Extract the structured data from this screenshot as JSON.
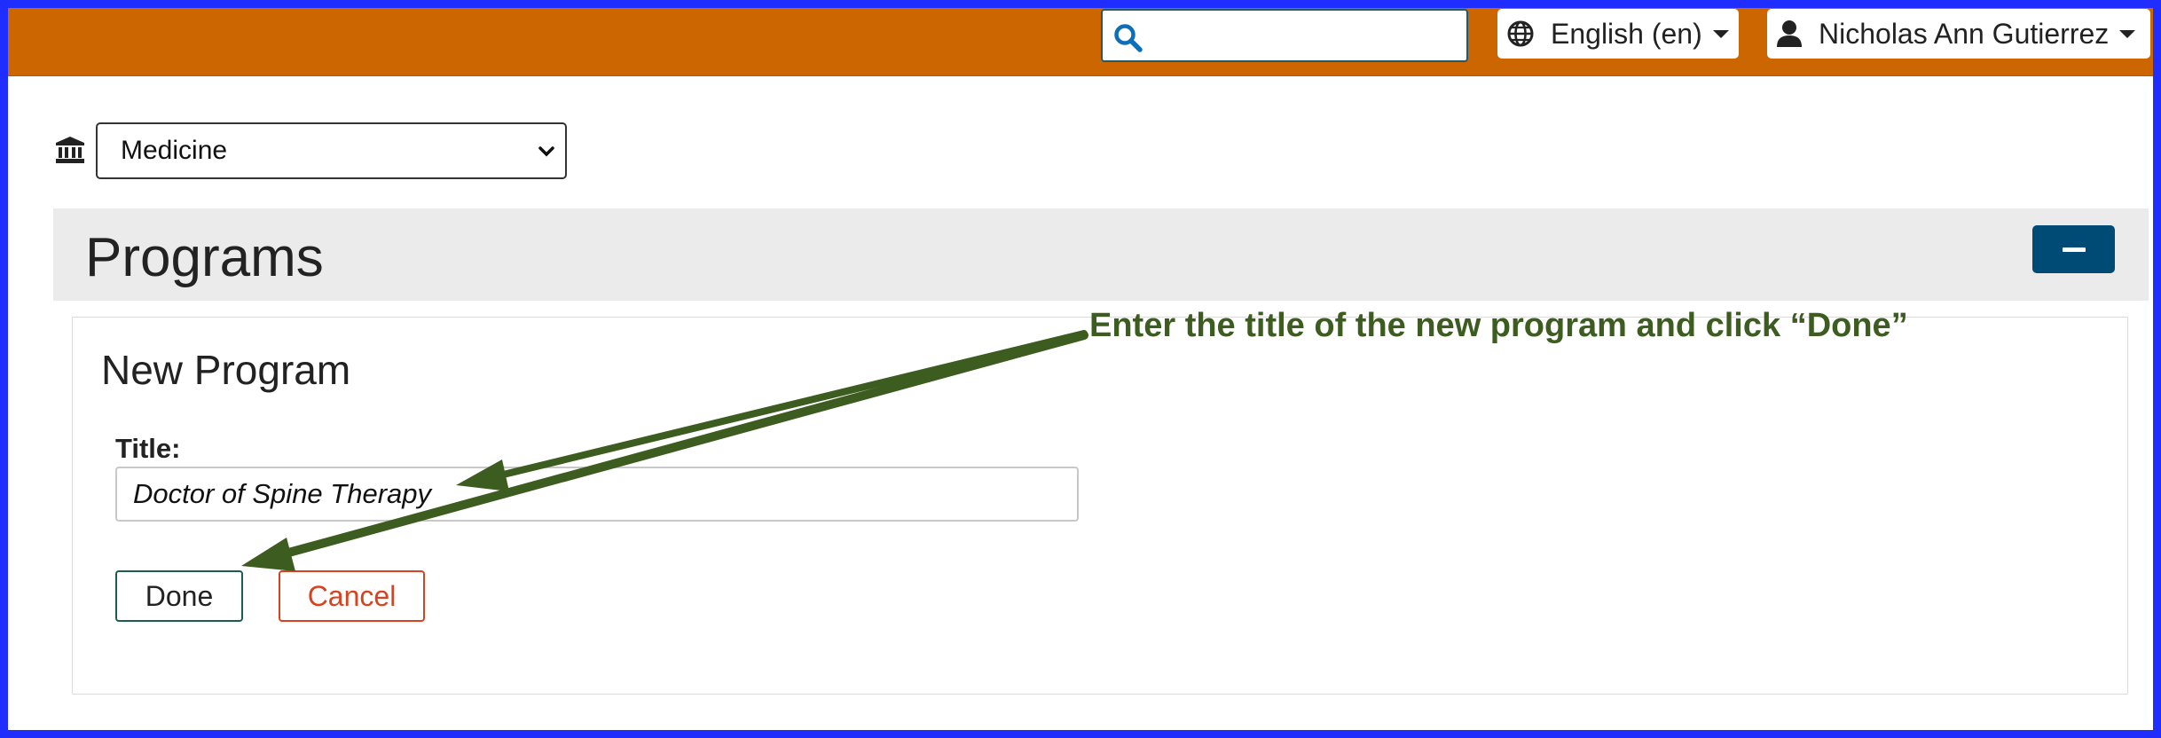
{
  "header": {
    "search": {
      "placeholder": "",
      "value": ""
    },
    "language": {
      "label": "English (en)"
    },
    "user": {
      "name": "Nicholas Ann Gutierrez"
    },
    "accent_color": "#cc6600"
  },
  "institution_select": {
    "selected": "Medicine"
  },
  "page": {
    "title": "Programs",
    "collapse_button_symbol": "−"
  },
  "form": {
    "heading": "New Program",
    "title_label": "Title:",
    "title_value": "Doctor of Spine Therapy",
    "done_label": "Done",
    "cancel_label": "Cancel"
  },
  "annotation": {
    "text": "Enter the title of the new program and click “Done”",
    "color": "#3d5c1f"
  },
  "icons": [
    "search-icon",
    "globe-icon",
    "user-icon",
    "caret-down-icon",
    "institution-icon",
    "chevron-down-icon",
    "minus-icon"
  ]
}
